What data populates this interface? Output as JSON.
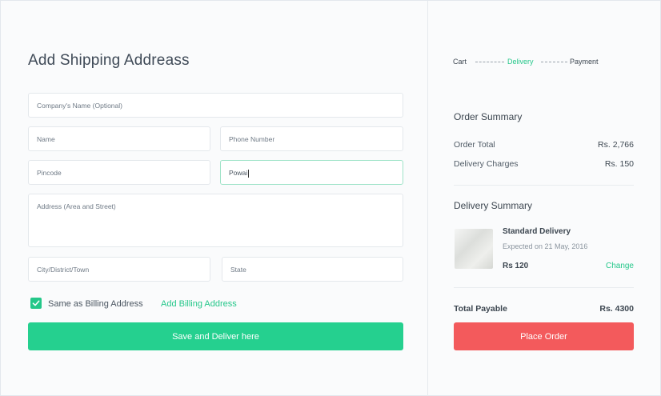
{
  "form": {
    "title": "Add Shipping Addreass",
    "fields": {
      "company": {
        "placeholder": "Company's Name (Optional)",
        "value": ""
      },
      "name": {
        "placeholder": "Name",
        "value": ""
      },
      "phone": {
        "placeholder": "Phone Number",
        "value": ""
      },
      "pincode": {
        "placeholder": "Pincode",
        "value": ""
      },
      "locality": {
        "placeholder": "",
        "value": "Powai"
      },
      "address": {
        "placeholder": "Address (Area and Street)",
        "value": ""
      },
      "city": {
        "placeholder": "City/District/Town",
        "value": ""
      },
      "state": {
        "placeholder": "State",
        "value": ""
      }
    },
    "same_as_billing": {
      "label": "Same as Billing Address",
      "checked": true
    },
    "add_billing_link": "Add Billing Address",
    "submit_label": "Save and Deliver here"
  },
  "progress": {
    "steps": [
      "Cart",
      "Delivery",
      "Payment"
    ],
    "current": "Delivery"
  },
  "order_summary": {
    "title": "Order Summary",
    "rows": [
      {
        "label": "Order Total",
        "value": "Rs. 2,766"
      },
      {
        "label": "Delivery Charges",
        "value": "Rs. 150"
      }
    ]
  },
  "delivery_summary": {
    "title": "Delivery Summary",
    "method": "Standard Delivery",
    "expected": "Expected on 21 May, 2016",
    "price": "Rs 120",
    "change_label": "Change"
  },
  "total": {
    "label": "Total Payable",
    "value": "Rs. 4300"
  },
  "place_order_label": "Place Order",
  "colors": {
    "accent_green": "#25d08f",
    "accent_red": "#f35a5c",
    "link_green": "#25c78a"
  }
}
